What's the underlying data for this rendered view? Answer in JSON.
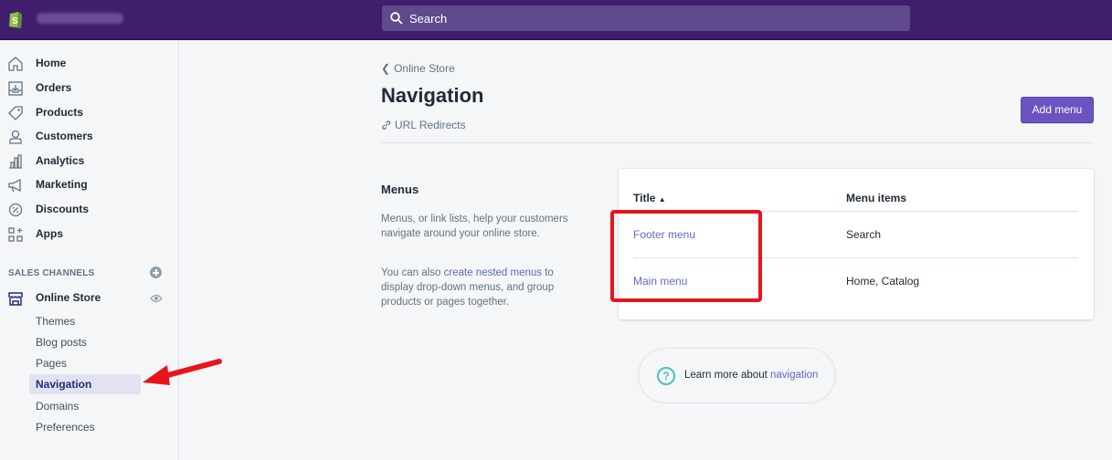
{
  "topbar": {
    "search_placeholder": "Search"
  },
  "sidebar": {
    "items": [
      {
        "label": "Home",
        "icon": "home-icon"
      },
      {
        "label": "Orders",
        "icon": "orders-icon"
      },
      {
        "label": "Products",
        "icon": "tag-icon"
      },
      {
        "label": "Customers",
        "icon": "person-icon"
      },
      {
        "label": "Analytics",
        "icon": "bar-chart-icon"
      },
      {
        "label": "Marketing",
        "icon": "megaphone-icon"
      },
      {
        "label": "Discounts",
        "icon": "discount-icon"
      },
      {
        "label": "Apps",
        "icon": "apps-icon"
      }
    ],
    "sales_channels_heading": "SALES CHANNELS",
    "online_store": {
      "label": "Online Store",
      "icon": "store-icon"
    },
    "sub_items": [
      {
        "label": "Themes"
      },
      {
        "label": "Blog posts"
      },
      {
        "label": "Pages"
      },
      {
        "label": "Navigation",
        "active": true
      },
      {
        "label": "Domains"
      },
      {
        "label": "Preferences"
      }
    ]
  },
  "main": {
    "breadcrumb": "Online Store",
    "title": "Navigation",
    "redirects_link": "URL Redirects",
    "add_menu_label": "Add menu",
    "menus_section": {
      "title": "Menus",
      "description": "Menus, or link lists, help your customers navigate around your online store.",
      "nested_prefix": "You can also ",
      "nested_link": "create nested menus",
      "nested_suffix": " to display drop-down menus, and group products or pages together."
    },
    "table": {
      "col_title": "Title",
      "col_items": "Menu items",
      "rows": [
        {
          "title": "Footer menu",
          "items": "Search"
        },
        {
          "title": "Main menu",
          "items": "Home, Catalog"
        }
      ]
    },
    "learn_more": {
      "prefix": "Learn more about ",
      "link": "navigation"
    }
  },
  "colors": {
    "topbar": "#3f1e6e",
    "accent": "#6c53c2",
    "link": "#5c6ac4",
    "annotation": "#e8141c"
  }
}
